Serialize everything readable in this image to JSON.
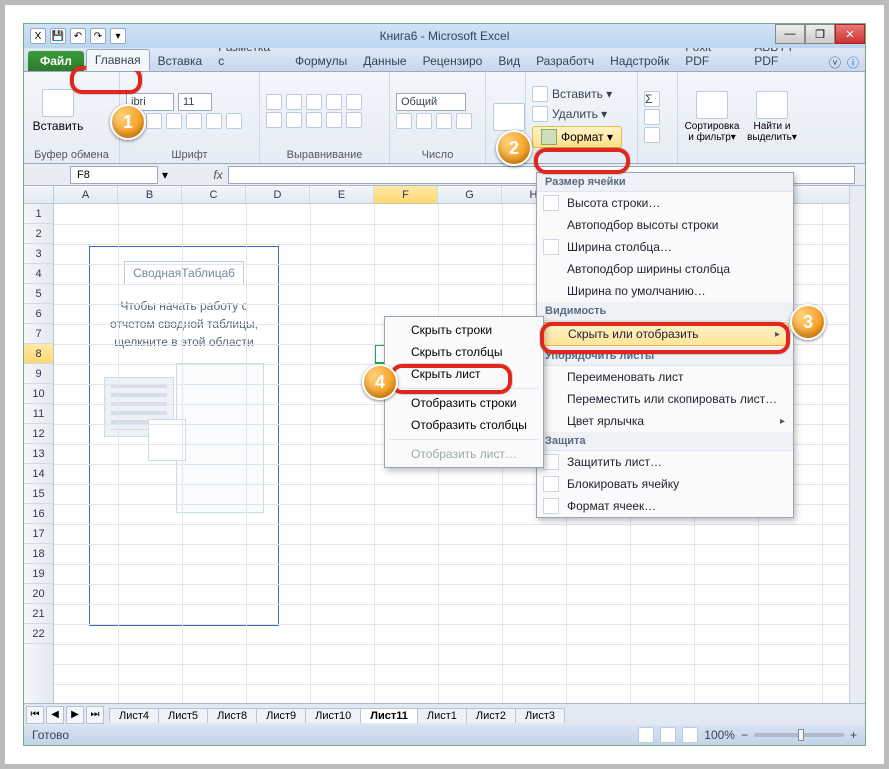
{
  "title": "Книга6 - Microsoft Excel",
  "window": {
    "min": "—",
    "max": "❐",
    "close": "✕"
  },
  "tabs": {
    "file": "Файл",
    "items": [
      "Главная",
      "Вставка",
      "Разметка с",
      "Формулы",
      "Данные",
      "Рецензиро",
      "Вид",
      "Разработч",
      "Надстройк",
      "Foxit PDF",
      "ABBYY PDF"
    ]
  },
  "ribbon": {
    "clipboard": {
      "label": "Буфер обмена",
      "paste": "Вставить"
    },
    "font": {
      "label": "Шрифт",
      "name": "ibri",
      "size": "11"
    },
    "align": {
      "label": "Выравнивание"
    },
    "number": {
      "label": "Число",
      "fmt": "Общий"
    },
    "cells": {
      "insert": "Вставить ▾",
      "delete": "Удалить ▾",
      "format": "Формат ▾"
    },
    "editing": {
      "sort": "Сортировка и фильтр▾",
      "find": "Найти и выделить▾"
    }
  },
  "namebox": "F8",
  "columns": [
    "A",
    "B",
    "C",
    "D",
    "E",
    "F",
    "G",
    "H"
  ],
  "rows": [
    "1",
    "2",
    "3",
    "4",
    "5",
    "6",
    "7",
    "8",
    "9",
    "10",
    "11",
    "12",
    "13",
    "14",
    "15",
    "16",
    "17",
    "18",
    "19",
    "20",
    "21",
    "22"
  ],
  "selected": {
    "col": "F",
    "row": "8"
  },
  "pivot": {
    "title": "СводнаяТаблица6",
    "msg_l1": "Чтобы начать работу с",
    "msg_l2": "отчетом сводной таблицы,",
    "msg_l3": "щелкните в этой области"
  },
  "sheet_tabs": {
    "list": [
      "Лист4",
      "Лист5",
      "Лист8",
      "Лист9",
      "Лист10",
      "Лист11",
      "Лист1",
      "Лист2",
      "Лист3"
    ],
    "active": "Лист11"
  },
  "status": {
    "ready": "Готово",
    "zoom": "100%"
  },
  "format_menu": {
    "hdr_size": "Размер ячейки",
    "row_h": "Высота строки…",
    "row_auto": "Автоподбор высоты строки",
    "col_w": "Ширина столбца…",
    "col_auto": "Автоподбор ширины столбца",
    "def_w": "Ширина по умолчанию…",
    "hdr_vis": "Видимость",
    "hide_show": "Скрыть или отобразить",
    "hdr_org": "Упорядочить листы",
    "rename": "Переименовать лист",
    "move": "Переместить или скопировать лист…",
    "tabcolor": "Цвет ярлычка",
    "hdr_prot": "Защита",
    "protect": "Защитить лист…",
    "lock": "Блокировать ячейку",
    "fcells": "Формат ячеек…"
  },
  "hide_submenu": {
    "hide_rows": "Скрыть строки",
    "hide_cols": "Скрыть столбцы",
    "hide_sheet": "Скрыть лист",
    "show_rows": "Отобразить строки",
    "show_cols": "Отобразить столбцы",
    "show_sheet": "Отобразить лист…"
  }
}
